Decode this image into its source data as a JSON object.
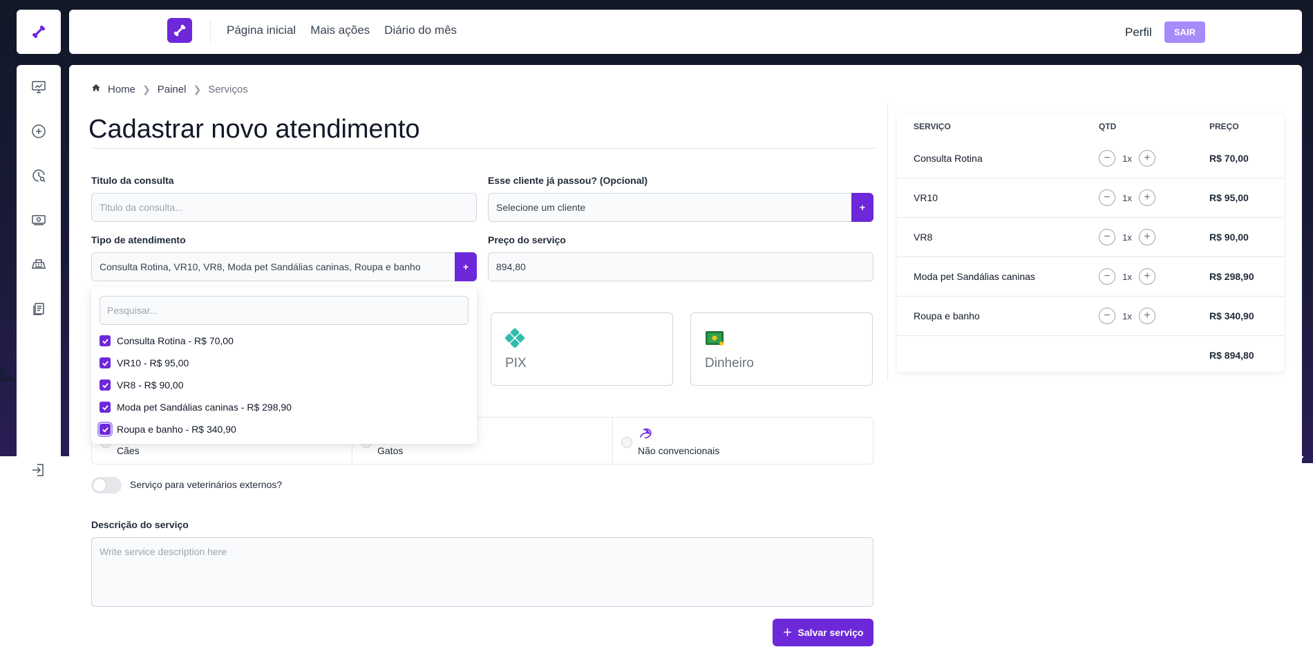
{
  "colors": {
    "primary": "#6d28d9",
    "sair": "#a78bfa",
    "dark_bg": "#111827"
  },
  "topbar": {
    "nav": [
      "Página inicial",
      "Mais ações",
      "Diário do mês"
    ],
    "perfil": "Perfil",
    "sair": "SAIR"
  },
  "sidebar": {
    "icons": [
      "chart-board-icon",
      "add-circle-icon",
      "clock-search-icon",
      "money-icon",
      "cash-register-icon",
      "clipboard-icon",
      "logout-icon"
    ]
  },
  "breadcrumb": {
    "home": "Home",
    "painel": "Painel",
    "current": "Serviços"
  },
  "page_title": "Cadastrar novo atendimento",
  "form": {
    "titulo_label": "Titulo da consulta",
    "titulo_placeholder": "Titulo da consulta...",
    "cliente_label": "Esse cliente já passou? (Opcional)",
    "cliente_value": "Selecione um cliente",
    "tipo_label": "Tipo de atendimento",
    "tipo_value": "Consulta Rotina, VR10, VR8, Moda pet Sandálias caninas, Roupa e banho",
    "preco_label": "Preço do serviço",
    "preco_value": "894,80",
    "plus": "+",
    "payment_methods": [
      "PIX",
      "Dinheiro"
    ],
    "animals": [
      "Cães",
      "Gatos",
      "Não convencionais"
    ],
    "toggle_label": "Serviço para veterinários externos?",
    "descricao_label": "Descrição do serviço",
    "descricao_placeholder": "Write service description here",
    "save": "Salvar serviço"
  },
  "dropdown": {
    "search_placeholder": "Pesquisar...",
    "options": [
      {
        "label": "Consulta Rotina - R$ 70,00",
        "checked": true
      },
      {
        "label": "VR10 - R$ 95,00",
        "checked": true
      },
      {
        "label": "VR8 - R$ 90,00",
        "checked": true
      },
      {
        "label": "Moda pet Sandálias caninas - R$ 298,90",
        "checked": true
      },
      {
        "label": "Roupa e banho - R$ 340,90",
        "checked": true
      }
    ]
  },
  "cart": {
    "headers": {
      "servico": "SERVIÇO",
      "qtd": "QTD",
      "preco": "PREÇO"
    },
    "rows": [
      {
        "name": "Consulta Rotina",
        "qty": "1x",
        "price": "R$ 70,00"
      },
      {
        "name": "VR10",
        "qty": "1x",
        "price": "R$ 95,00"
      },
      {
        "name": "VR8",
        "qty": "1x",
        "price": "R$ 90,00"
      },
      {
        "name": "Moda pet Sandálias caninas",
        "qty": "1x",
        "price": "R$ 298,90"
      },
      {
        "name": "Roupa e banho",
        "qty": "1x",
        "price": "R$ 340,90"
      }
    ],
    "total": "R$ 894,80"
  }
}
